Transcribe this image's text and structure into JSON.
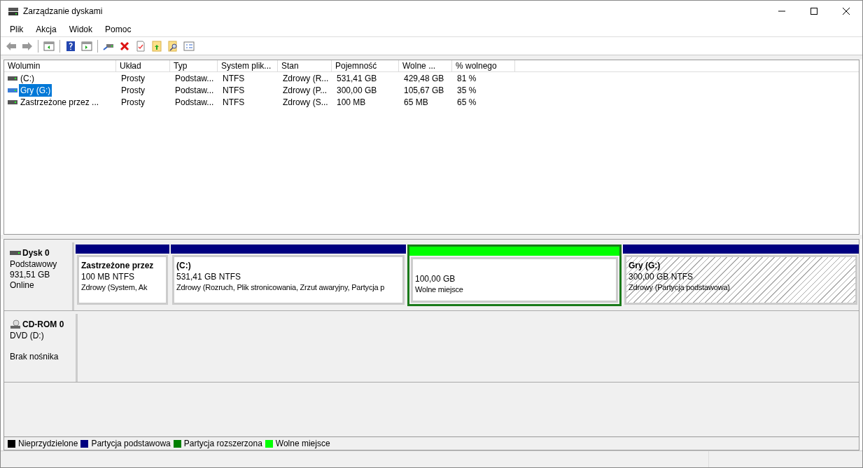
{
  "window": {
    "title": "Zarządzanie dyskami"
  },
  "menu": [
    "Plik",
    "Akcja",
    "Widok",
    "Pomoc"
  ],
  "toolbar": [
    {
      "kind": "back",
      "disabled": true
    },
    {
      "kind": "forward",
      "disabled": true
    },
    {
      "kind": "sep"
    },
    {
      "kind": "console"
    },
    {
      "kind": "sep"
    },
    {
      "kind": "help"
    },
    {
      "kind": "panel"
    },
    {
      "kind": "sep"
    },
    {
      "kind": "connect"
    },
    {
      "kind": "delete"
    },
    {
      "kind": "check"
    },
    {
      "kind": "folderup"
    },
    {
      "kind": "foldersearch"
    },
    {
      "kind": "list"
    }
  ],
  "table": {
    "columns": [
      "Wolumin",
      "Układ",
      "Typ",
      "System plik...",
      "Stan",
      "Pojemność",
      "Wolne ...",
      "% wolnego"
    ],
    "rows": [
      {
        "selected": false,
        "cells": [
          " (C:)",
          "Prosty",
          "Podstaw...",
          "NTFS",
          "Zdrowy (R...",
          "531,41 GB",
          "429,48 GB",
          "81 %"
        ]
      },
      {
        "selected": true,
        "cells": [
          "Gry (G:)",
          "Prosty",
          "Podstaw...",
          "NTFS",
          "Zdrowy (P...",
          "300,00 GB",
          "105,67 GB",
          "35 %"
        ]
      },
      {
        "selected": false,
        "cells": [
          "Zastrzeżone przez ...",
          "Prosty",
          "Podstaw...",
          "NTFS",
          "Zdrowy (S...",
          "100 MB",
          "65 MB",
          "65 %"
        ]
      }
    ]
  },
  "disks": [
    {
      "kind": "disk",
      "name": "Dysk 0",
      "lines": [
        "Podstawowy",
        "931,51 GB",
        "Online"
      ],
      "partitions": [
        {
          "color": "#000080",
          "name": "Zastrzeżone przez",
          "size": "100 MB NTFS",
          "status": "Zdrowy (System, Ak",
          "hatched": false,
          "focused": false
        },
        {
          "color": "#000080",
          "name": " (C:)",
          "size": "531,41 GB NTFS",
          "status": "Zdrowy (Rozruch, Plik stronicowania, Zrzut awaryjny, Partycja p",
          "hatched": false,
          "focused": false
        },
        {
          "color": "#00ff00",
          "size": "100,00 GB",
          "status": "Wolne miejsce",
          "hatched": false,
          "focused": true
        },
        {
          "color": "#000080",
          "name": "Gry  (G:)",
          "size": "300,00 GB NTFS",
          "status": "Zdrowy (Partycja podstawowa)",
          "hatched": true,
          "focused": false
        }
      ]
    },
    {
      "kind": "cdrom",
      "name": "CD-ROM 0",
      "lines": [
        "DVD (D:)",
        "Brak nośnika"
      ]
    }
  ],
  "legend": [
    {
      "label": "Nieprzydzielone",
      "color": "#000000"
    },
    {
      "label": "Partycja podstawowa",
      "color": "#000080"
    },
    {
      "label": "Partycja rozszerzona",
      "color": "#008000"
    },
    {
      "label": "Wolne miejsce",
      "color": "#00ff00"
    }
  ]
}
